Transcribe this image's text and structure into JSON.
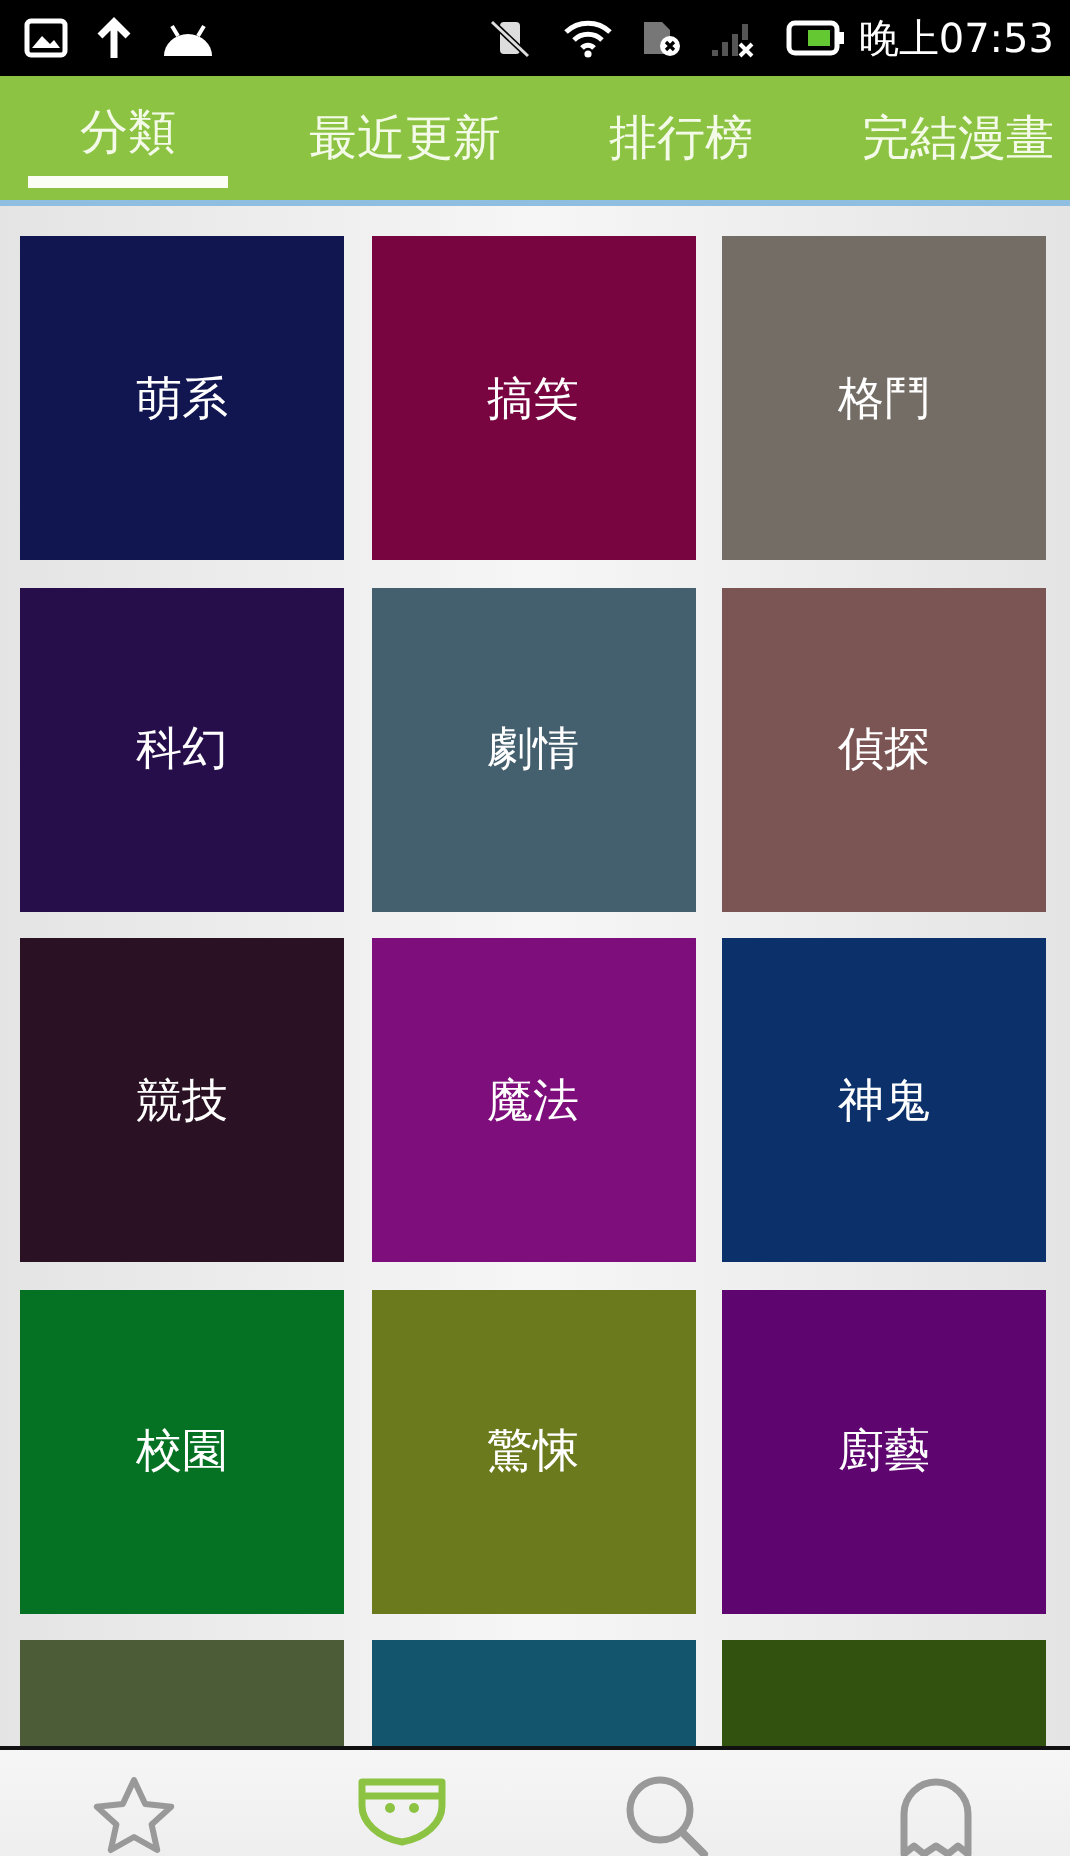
{
  "status_bar": {
    "time": "晚上07:53"
  },
  "tabs": [
    {
      "label": "分類",
      "selected": true
    },
    {
      "label": "最近更新",
      "selected": false
    },
    {
      "label": "排行榜",
      "selected": false
    },
    {
      "label": "完結漫畫",
      "selected": false
    }
  ],
  "categories": [
    {
      "label": "萌系",
      "color": "#121650"
    },
    {
      "label": "搞笑",
      "color": "#780540"
    },
    {
      "label": "格鬥",
      "color": "#736d66"
    },
    {
      "label": "科幻",
      "color": "#260e4b"
    },
    {
      "label": "劇情",
      "color": "#445f6e"
    },
    {
      "label": "偵探",
      "color": "#7b5554"
    },
    {
      "label": "競技",
      "color": "#2a1124"
    },
    {
      "label": "魔法",
      "color": "#7e0e7b"
    },
    {
      "label": "神鬼",
      "color": "#0b306a"
    },
    {
      "label": "校園",
      "color": "#057223"
    },
    {
      "label": "驚悚",
      "color": "#6a7a1c"
    },
    {
      "label": "廚藝",
      "color": "#5e056f"
    },
    {
      "color": "#4b5c37"
    },
    {
      "color": "#14556e"
    },
    {
      "color": "#31530f"
    }
  ],
  "bottom_nav": [
    {
      "kind": "star",
      "selected": false
    },
    {
      "kind": "diaper",
      "selected": true
    },
    {
      "kind": "search",
      "selected": false
    },
    {
      "kind": "ghost",
      "selected": false
    }
  ]
}
